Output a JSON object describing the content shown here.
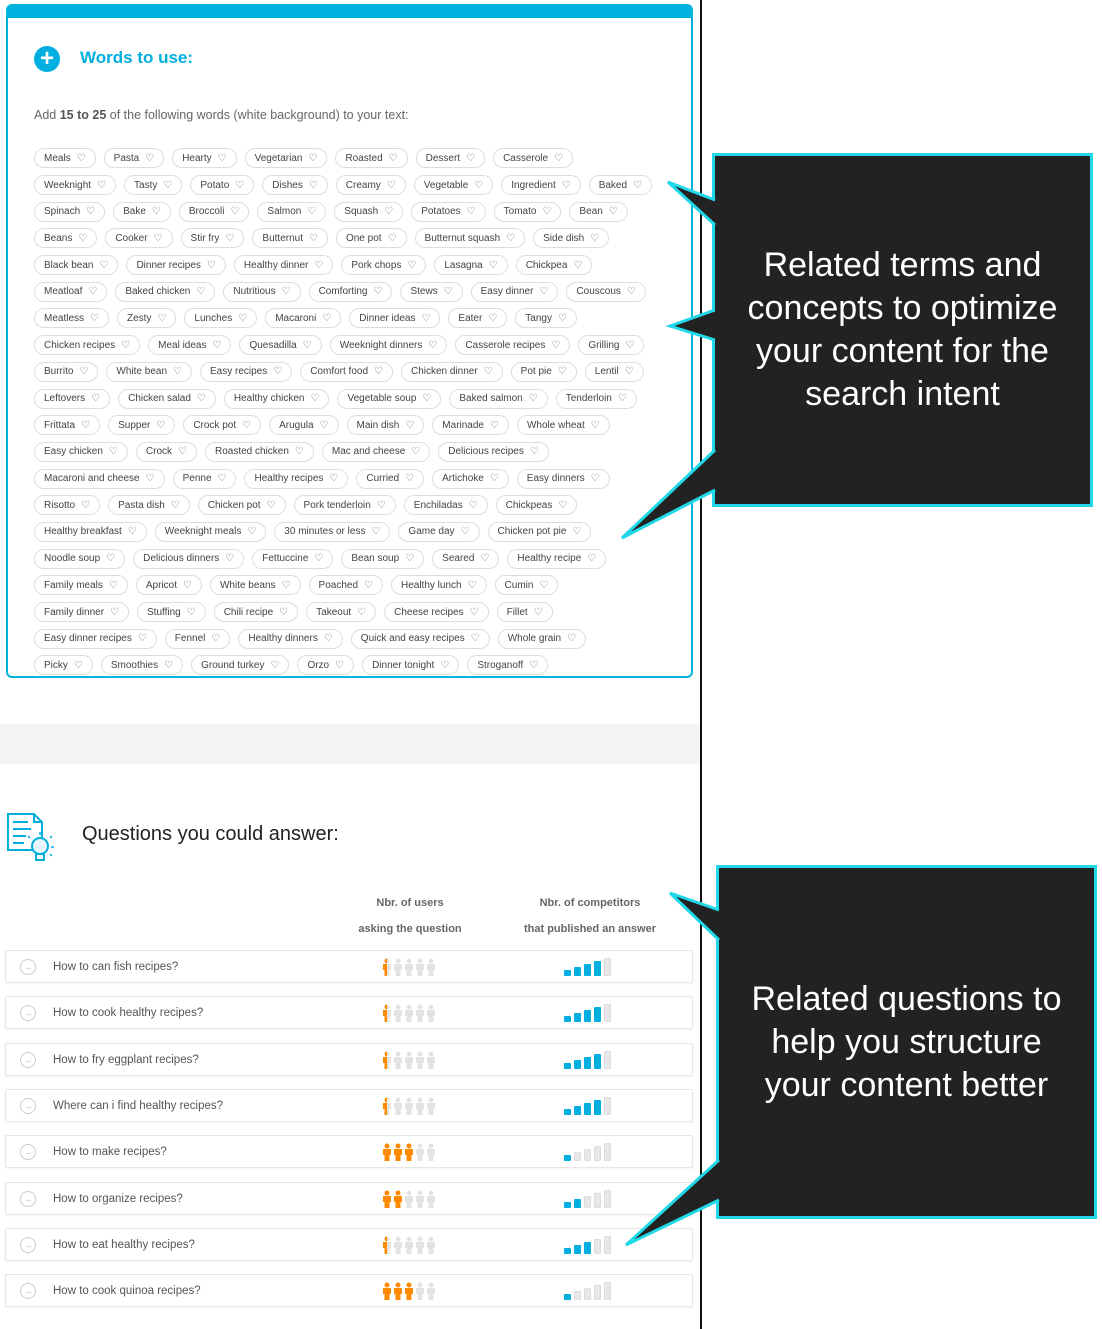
{
  "words": {
    "title": "Words to use:",
    "instr_pre": "Add ",
    "instr_bold": "15 to 25",
    "instr_post": " of the following words (white background) to your text:",
    "rows": [
      [
        "Meals",
        "Pasta",
        "Hearty",
        "Vegetarian",
        "Roasted",
        "Dessert",
        "Casserole"
      ],
      [
        "Weeknight",
        "Tasty",
        "Potato",
        "Dishes",
        "Creamy",
        "Vegetable",
        "Ingredient",
        "Baked"
      ],
      [
        "Spinach",
        "Bake",
        "Broccoli",
        "Salmon",
        "Squash",
        "Potatoes",
        "Tomato",
        "Bean"
      ],
      [
        "Beans",
        "Cooker",
        "Stir fry",
        "Butternut",
        "One pot",
        "Butternut squash",
        "Side dish"
      ],
      [
        "Black bean",
        "Dinner recipes",
        "Healthy dinner",
        "Pork chops",
        "Lasagna",
        "Chickpea"
      ],
      [
        "Meatloaf",
        "Baked chicken",
        "Nutritious",
        "Comforting",
        "Stews",
        "Easy dinner",
        "Couscous"
      ],
      [
        "Meatless",
        "Zesty",
        "Lunches",
        "Macaroni",
        "Dinner ideas",
        "Eater",
        "Tangy"
      ],
      [
        "Chicken recipes",
        "Meal ideas",
        "Quesadilla",
        "Weeknight dinners",
        "Casserole recipes",
        "Grilling"
      ],
      [
        "Burrito",
        "White bean",
        "Easy recipes",
        "Comfort food",
        "Chicken dinner",
        "Pot pie",
        "Lentil"
      ],
      [
        "Leftovers",
        "Chicken salad",
        "Healthy chicken",
        "Vegetable soup",
        "Baked salmon",
        "Tenderloin"
      ],
      [
        "Frittata",
        "Supper",
        "Crock pot",
        "Arugula",
        "Main dish",
        "Marinade",
        "Whole wheat"
      ],
      [
        "Easy chicken",
        "Crock",
        "Roasted chicken",
        "Mac and cheese",
        "Delicious recipes"
      ],
      [
        "Macaroni and cheese",
        "Penne",
        "Healthy recipes",
        "Curried",
        "Artichoke",
        "Easy dinners"
      ],
      [
        "Risotto",
        "Pasta dish",
        "Chicken pot",
        "Pork tenderloin",
        "Enchiladas",
        "Chickpeas"
      ],
      [
        "Healthy breakfast",
        "Weeknight meals",
        "30 minutes or less",
        "Game day",
        "Chicken pot pie"
      ],
      [
        "Noodle soup",
        "Delicious dinners",
        "Fettuccine",
        "Bean soup",
        "Seared",
        "Healthy recipe"
      ],
      [
        "Family meals",
        "Apricot",
        "White beans",
        "Poached",
        "Healthy lunch",
        "Cumin"
      ],
      [
        "Family dinner",
        "Stuffing",
        "Chili recipe",
        "Takeout",
        "Cheese recipes",
        "Fillet"
      ],
      [
        "Easy dinner recipes",
        "Fennel",
        "Healthy dinners",
        "Quick and easy recipes",
        "Whole grain"
      ],
      [
        "Picky",
        "Smoothies",
        "Ground turkey",
        "Orzo",
        "Dinner tonight",
        "Stroganoff"
      ]
    ]
  },
  "questions": {
    "title": "Questions you could answer:",
    "col_users_1": "Nbr. of users",
    "col_users_2": "asking the question",
    "col_comp_1": "Nbr. of competitors",
    "col_comp_2": "that published an answer",
    "items": [
      {
        "text": "How to can fish recipes?",
        "users": 0.5,
        "competitors": 4
      },
      {
        "text": "How to cook healthy recipes?",
        "users": 0.5,
        "competitors": 4
      },
      {
        "text": "How to fry eggplant recipes?",
        "users": 0.5,
        "competitors": 4
      },
      {
        "text": "Where can i find healthy recipes?",
        "users": 0.5,
        "competitors": 4
      },
      {
        "text": "How to make recipes?",
        "users": 3,
        "competitors": 1
      },
      {
        "text": "How to organize recipes?",
        "users": 2,
        "competitors": 2
      },
      {
        "text": "How to eat healthy recipes?",
        "users": 0.5,
        "competitors": 3
      },
      {
        "text": "How to cook quinoa recipes?",
        "users": 3,
        "competitors": 1
      }
    ]
  },
  "callouts": {
    "terms": "Related terms and concepts to optimize your content for the search intent",
    "questions": "Related questions to help you structure your content better"
  },
  "colors": {
    "accent": "#00aee0",
    "user_on": "#ff8a00",
    "user_off": "#e3e3e3",
    "callout_border": "#20d8e8",
    "callout_bg": "#222222"
  }
}
